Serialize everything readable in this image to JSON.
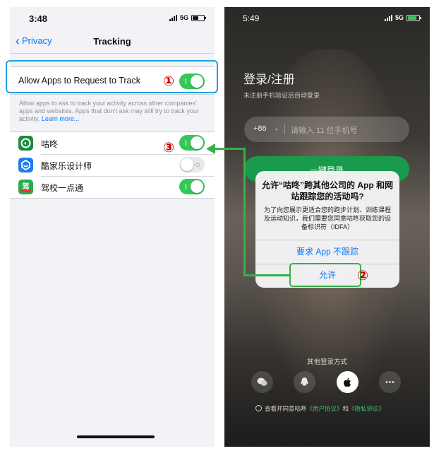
{
  "left_phone": {
    "status": {
      "time": "3:48",
      "network": "5G"
    },
    "nav": {
      "back_label": "Privacy",
      "title": "Tracking"
    },
    "allow_tracking": {
      "label": "Allow Apps to Request to Track",
      "on": true
    },
    "footer": {
      "text": "Allow apps to ask to track your activity across other companies' apps and websites. Apps that don't ask may still try to track your activity.",
      "learn_more": "Learn more..."
    },
    "apps": [
      {
        "name": "咕咚",
        "on": true,
        "icon": "gudong-app-icon",
        "color": "#1f8a3e"
      },
      {
        "name": "酷家乐设计师",
        "on": false,
        "icon": "kujiale-app-icon",
        "color": "#1e7cf2"
      },
      {
        "name": "驾校一点通",
        "on": true,
        "icon": "jiaxiao-app-icon",
        "color": "#22b04b"
      }
    ]
  },
  "right_phone": {
    "status": {
      "time": "5:49",
      "network": "5G"
    },
    "login_title": "登录/注册",
    "login_sub": "未注册手机验证后自动登录",
    "country_code": "+86",
    "phone_placeholder": "请输入 11 位手机号",
    "one_click_login": "一键登录",
    "alert": {
      "title": "允许“咕咚”跨其他公司的 App 和网站跟踪您的活动吗?",
      "message": "为了向您展示更适合您的跑步计划、训练课程及运动知识，我们需要您同意咕咚获取您的设备标识符（IDFA）",
      "ask_not_track": "要求 App 不跟踪",
      "allow": "允许"
    },
    "other_login": "其他登录方式",
    "social_icons": [
      "wechat-icon",
      "qq-icon",
      "apple-icon",
      "more-icon"
    ],
    "agree": {
      "prefix": "查看并同意咕咚",
      "user_agreement": "《用户协议》",
      "and": "和",
      "privacy_policy": "《隐私协议》"
    }
  },
  "annotations": {
    "step1": "①",
    "step2": "②",
    "step3": "③",
    "highlight_blue": "#1aa0e0",
    "highlight_green": "#34b14a",
    "number_color": "#c00000"
  }
}
